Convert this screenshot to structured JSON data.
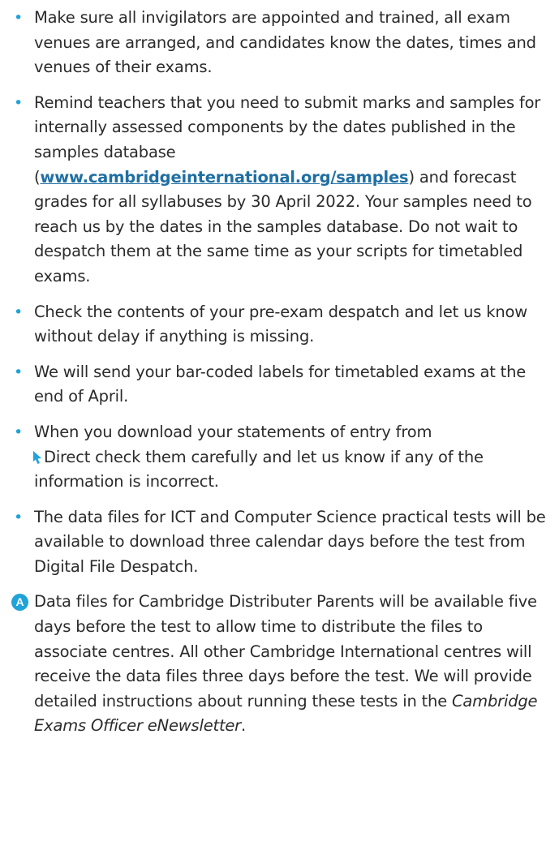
{
  "bullets": [
    {
      "text": "Make sure all invigilators are appointed and trained, all exam venues are arranged, and candidates know the dates, times and venues of their exams."
    },
    {
      "before": "Remind teachers that you need to submit marks and samples for internally assessed components by the dates published in the samples database (",
      "link": "www.cambridgeinternational.org/samples",
      "after": ") and forecast grades for all syllabuses by 30 April 2022. Your samples need to reach us by the dates in the samples database. Do not wait to despatch them at the same time as your scripts for timetabled exams."
    },
    {
      "text": "Check the contents of your pre-exam despatch and let us know without delay if anything is missing."
    },
    {
      "text": "We will send your bar-coded labels for timetabled exams at the end of April."
    },
    {
      "before": "When you download your statements of entry from",
      "brand": "Direct",
      "after": " check them carefully and let us know if any of the information is incorrect."
    },
    {
      "text": "The data files for ICT and Computer Science practical tests will be available to download three calendar days before the test from Digital File Despatch."
    }
  ],
  "note": {
    "badge": "A",
    "before": "Data files for Cambridge Distributer Parents will be available five days before the test to allow time to distribute the files to associate centres. All other Cambridge International centres will receive the data files three days before the test. We will provide detailed instructions about running these tests in the ",
    "italic": "Cambridge Exams Officer eNewsletter",
    "after": "."
  },
  "colors": {
    "bullet": "#1fa3d9",
    "link": "#1f6fa3",
    "text": "#2b2b2b"
  },
  "icons": {
    "bullet": "bullet-dot-icon",
    "direct_logo": "cursor-arrow-icon"
  }
}
